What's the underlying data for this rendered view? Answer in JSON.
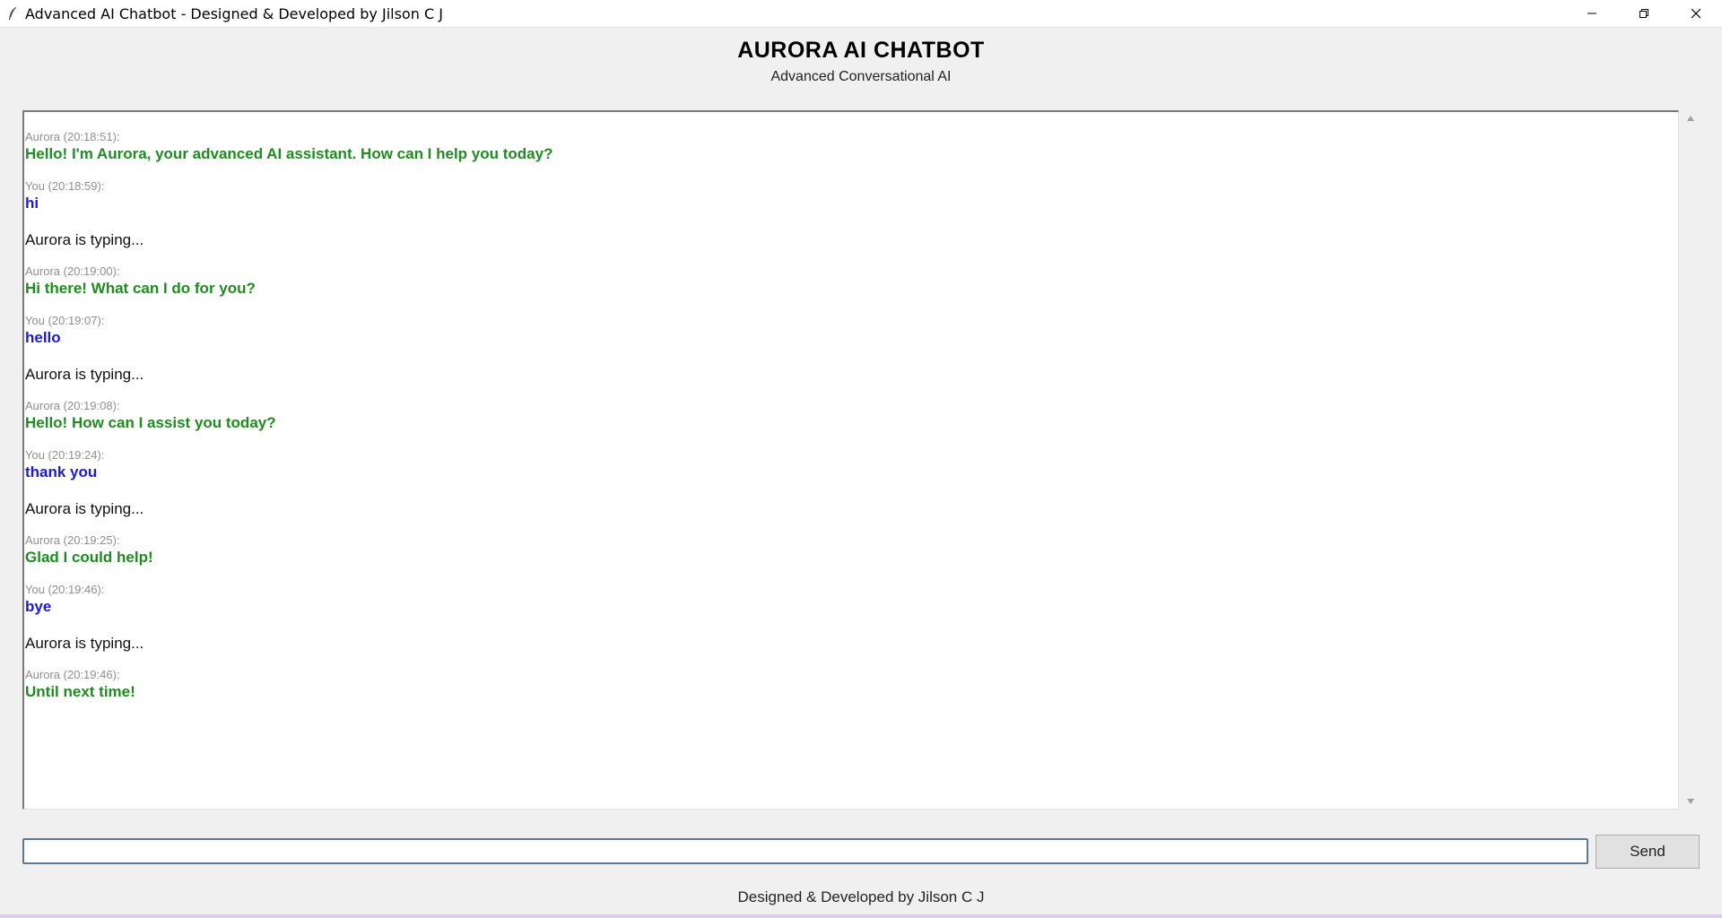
{
  "window": {
    "title": "Advanced AI Chatbot - Designed & Developed by Jilson C J",
    "icon": "feather-icon",
    "controls": [
      "minimize-icon",
      "restore-icon",
      "close-icon"
    ]
  },
  "header": {
    "title": "AURORA AI CHATBOT",
    "subtitle": "Advanced Conversational AI"
  },
  "colors": {
    "aurora_text": "#1e8c1e",
    "user_text": "#1a1adc",
    "timestamp": "#8f8f8f",
    "background": "#f0f0f0"
  },
  "chat": {
    "messages": [
      {
        "kind": "aurora",
        "timestamp": "Aurora (20:18:51):",
        "text": "Hello! I'm Aurora, your advanced AI assistant. How can I help you today?"
      },
      {
        "kind": "user",
        "timestamp": "You (20:18:59):",
        "text": "hi"
      },
      {
        "kind": "typing",
        "text": "Aurora is typing..."
      },
      {
        "kind": "aurora",
        "timestamp": "Aurora (20:19:00):",
        "text": "Hi there! What can I do for you?"
      },
      {
        "kind": "user",
        "timestamp": "You (20:19:07):",
        "text": "hello"
      },
      {
        "kind": "typing",
        "text": "Aurora is typing..."
      },
      {
        "kind": "aurora",
        "timestamp": "Aurora (20:19:08):",
        "text": "Hello! How can I assist you today?"
      },
      {
        "kind": "user",
        "timestamp": "You (20:19:24):",
        "text": "thank you"
      },
      {
        "kind": "typing",
        "text": "Aurora is typing..."
      },
      {
        "kind": "aurora",
        "timestamp": "Aurora (20:19:25):",
        "text": "Glad I could help!"
      },
      {
        "kind": "user",
        "timestamp": "You (20:19:46):",
        "text": "bye"
      },
      {
        "kind": "typing",
        "text": "Aurora is typing..."
      },
      {
        "kind": "aurora",
        "timestamp": "Aurora (20:19:46):",
        "text": "Until next time!"
      }
    ]
  },
  "input": {
    "value": "",
    "placeholder": "",
    "send_label": "Send"
  },
  "footer": {
    "text": "Designed & Developed by Jilson C J"
  }
}
